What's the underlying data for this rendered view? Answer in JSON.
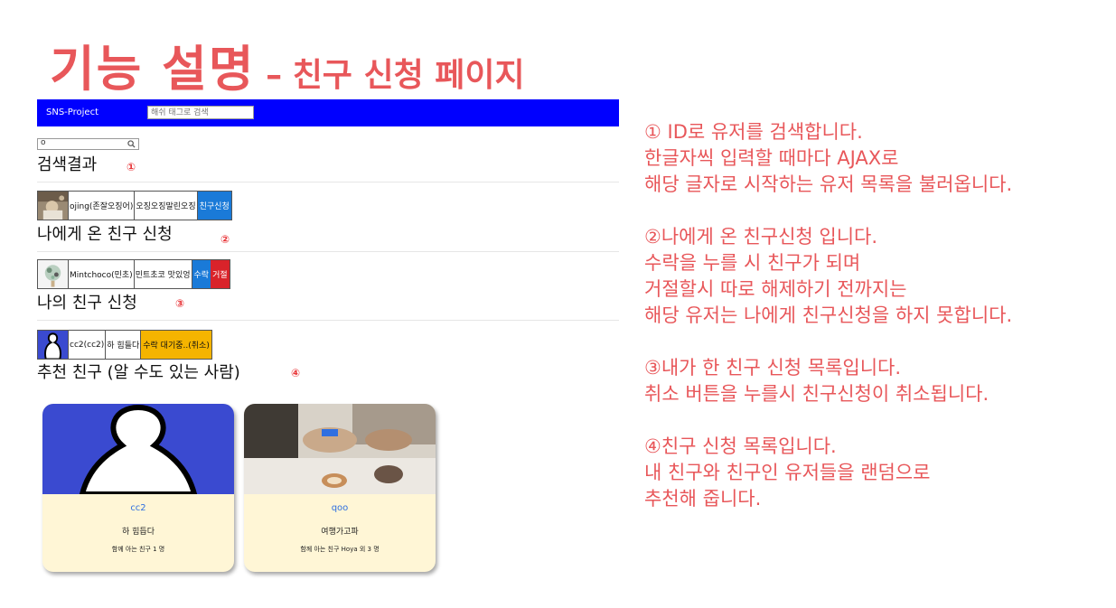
{
  "slide": {
    "title_main": "기능 설명",
    "title_sep": "–",
    "title_sub": "친구 신청 페이지"
  },
  "navbar": {
    "brand": "SNS-Project",
    "search_placeholder": "해쉬 태그로 검색"
  },
  "search": {
    "value": "o"
  },
  "sections": {
    "search_results": {
      "title": "검색결과",
      "badge": "①"
    },
    "received": {
      "title": "나에게 온 친구 신청",
      "badge": "②"
    },
    "sent": {
      "title": "나의 친구 신청",
      "badge": "③"
    },
    "recommend": {
      "title": "추천 친구 (알 수도 있는 사람)",
      "badge": "④"
    }
  },
  "search_result_row": {
    "name": "ojing(존잘오징어)",
    "status": "오징오징말린오징",
    "button": "친구신청"
  },
  "received_row": {
    "name": "Mintchoco(민초)",
    "status": "민트초코 맛있엉",
    "accept": "수락",
    "reject": "거절"
  },
  "sent_row": {
    "name": "cc2(cc2)",
    "status": "하 힘들다",
    "pending": "수락 대기중..(취소)"
  },
  "recommend_cards": [
    {
      "id": "cc2",
      "message": "하 힘듭다",
      "mutual": "함께 아는 친구 1 명"
    },
    {
      "id": "qoo",
      "message": "여행가고파",
      "mutual": "함께 아는 친구 Hoya 외 3 명"
    }
  ],
  "descriptions": [
    {
      "lines": [
        "① ID로 유저를 검색합니다.",
        "한글자씩 입력할 때마다 AJAX로",
        "해당 글자로 시작하는 유저 목록을 불러옵니다."
      ]
    },
    {
      "lines": [
        "②나에게 온 친구신청 입니다.",
        "수락을 누를 시 친구가 되며",
        "거절할시 따로 해제하기 전까지는",
        "해당 유저는 나에게 친구신청을 하지 못합니다."
      ]
    },
    {
      "lines": [
        "③내가 한 친구 신청 목록입니다.",
        "취소 버튼을 누를시 친구신청이 취소됩니다."
      ]
    },
    {
      "lines": [
        "④친구 신청 목록입니다.",
        "내 친구와 친구인 유저들을 랜덤으로",
        "추천해 줍니다."
      ]
    }
  ],
  "colors": {
    "accent": "#e8575a",
    "navbar": "#0000ff",
    "accept_button": "#1a7ad8",
    "reject_button": "#d9232a",
    "pending_button": "#f5b400",
    "card_bg": "#fff6d6"
  }
}
